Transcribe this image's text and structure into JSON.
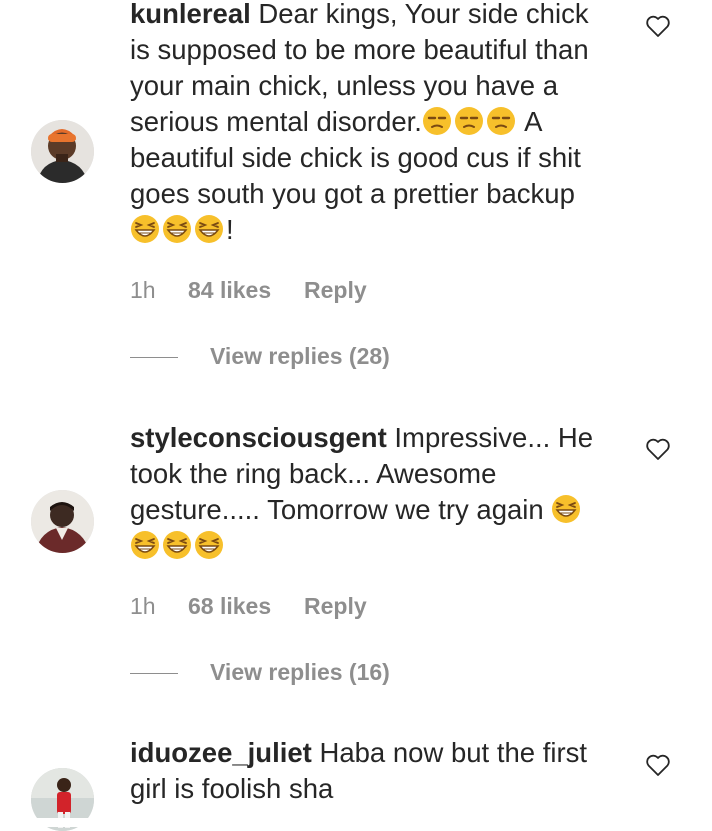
{
  "comments": [
    {
      "username": "kunlereal",
      "text_parts": [
        "Dear kings, Your side chick is supposed to be more beautiful than your main chick, unless you have a serious mental disorder.",
        "A beautiful side chick is good cus if shit goes south you got a prettier backup",
        "!"
      ],
      "emoji_groups": [
        "unamused",
        "laughing"
      ],
      "time": "1h",
      "likes": "84 likes",
      "reply": "Reply",
      "view_replies": "View replies (28)"
    },
    {
      "username": "styleconsciousgent",
      "text_parts": [
        "Impressive... He took the ring back... Awesome gesture..... Tomorrow we try again"
      ],
      "emoji_groups": [
        "laughing"
      ],
      "time": "1h",
      "likes": "68 likes",
      "reply": "Reply",
      "view_replies": "View replies (16)"
    },
    {
      "username": "iduozee_juliet",
      "text_parts": [
        "Haba now but the first girl is foolish sha"
      ]
    }
  ],
  "icons": {
    "like": "heart-outline-icon",
    "emoji_unamused": "unamused-face-emoji",
    "emoji_laughing": "grinning-squinting-face-emoji"
  },
  "colors": {
    "text": "#262626",
    "muted": "#8e8e8e",
    "emoji": "#f7c02b"
  }
}
